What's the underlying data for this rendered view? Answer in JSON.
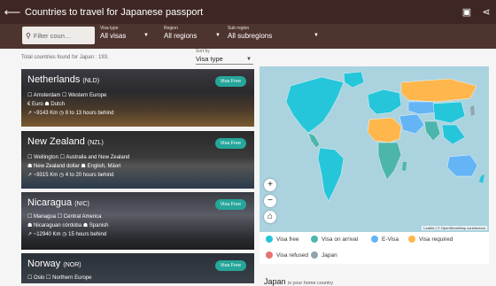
{
  "appbar": {
    "title": "Countries to travel for Japanese passport"
  },
  "filters": {
    "search_placeholder": "Filter coun…",
    "visa": {
      "label": "Visa type",
      "value": "All visas"
    },
    "region": {
      "label": "Region",
      "value": "All regions"
    },
    "subregion": {
      "label": "Sub region",
      "value": "All subregions"
    }
  },
  "total_text": "Total countries found for Japan : 193.",
  "sort": {
    "label": "Sort by",
    "value": "Visa type"
  },
  "cards": [
    {
      "name": "Netherlands",
      "code": "(NLD)",
      "loc": "☐ Amsterdam ☐ Western Europe",
      "cur": "€ Euro ☗ Dutch",
      "dist": "↗ ~9143 Km ◷ 8 to 13 hours behind",
      "badge": "Visa Free"
    },
    {
      "name": "New Zealand",
      "code": "(NZL)",
      "loc": "☐ Wellington ☐ Australia and New Zealand",
      "cur": "☗ New Zealand dollar ☗ English, Māori",
      "dist": "↗ ~9315 Km ◷ 4 to 20 hours behind",
      "badge": "Visa Free"
    },
    {
      "name": "Nicaragua",
      "code": "(NIC)",
      "loc": "☐ Managua ☐ Central America",
      "cur": "☗ Nicaraguan córdoba ☗ Spanish",
      "dist": "↗ ~12940 Km ◷ 15 hours behind",
      "badge": "Visa Free"
    },
    {
      "name": "Norway",
      "code": "(NOR)",
      "loc": "☐ Oslo ☐ Northern Europe",
      "cur": "",
      "dist": "",
      "badge": "Visa Free"
    }
  ],
  "map": {
    "attribution": "Leaflet | © OpenStreetMap contributors",
    "zoom_in": "+",
    "zoom_out": "−",
    "home": "⌂"
  },
  "legend": [
    {
      "label": "Visa free",
      "color": "#26c6da"
    },
    {
      "label": "Visa on arrival",
      "color": "#4db6ac"
    },
    {
      "label": "E-Visa",
      "color": "#64b5f6"
    },
    {
      "label": "Visa required",
      "color": "#ffb74d"
    },
    {
      "label": "Visa refused",
      "color": "#e57373"
    },
    {
      "label": "Japan",
      "color": "#90a4ae"
    }
  ],
  "home_country": {
    "name": "Japan",
    "sub": "is your home country"
  },
  "colors": {
    "appbar": "#3e2723",
    "filterbar": "#4e342e",
    "badge": "#26a69a"
  }
}
